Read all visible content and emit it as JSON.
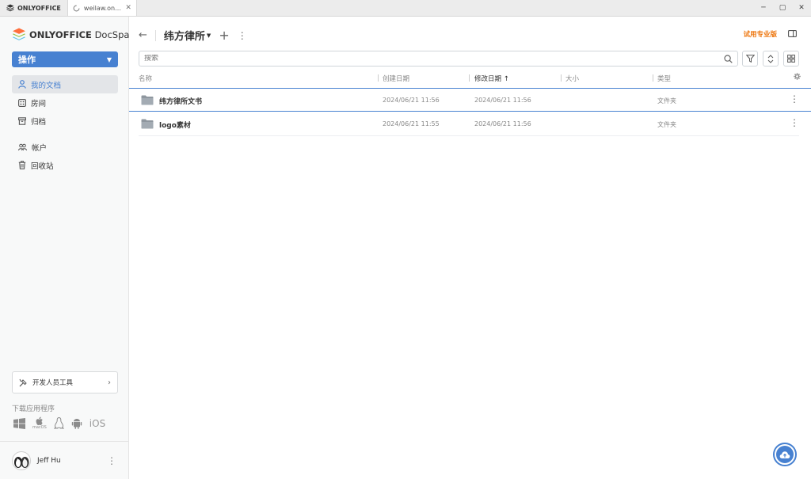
{
  "window": {
    "app_tab_label": "ONLYOFFICE",
    "doc_tab_label": "weilaw.onlyo...",
    "doc_tab_close": "✕"
  },
  "sidebar": {
    "logo_brand": "ONLYOFFICE",
    "logo_product": " DocSpace",
    "action_button": "操作",
    "nav": [
      {
        "label": "我的文档",
        "icon": "person-icon",
        "active": true
      },
      {
        "label": "房间",
        "icon": "rooms-icon",
        "active": false
      },
      {
        "label": "归档",
        "icon": "archive-icon",
        "active": false
      },
      {
        "label": "帐户",
        "icon": "accounts-icon",
        "active": false
      },
      {
        "label": "回收站",
        "icon": "trash-icon",
        "active": false
      }
    ],
    "dev_tools_label": "开发人员工具",
    "download_apps_label": "下载应用程序",
    "os_icons": [
      "windows-icon",
      "macos-icon",
      "linux-icon",
      "android-icon",
      "ios-icon"
    ],
    "macos_caption": "macOS",
    "ios_label": "iOS",
    "user_name": "Jeff Hu"
  },
  "header": {
    "folder_title": "纬方律所",
    "trial_link": "试用专业版"
  },
  "search": {
    "placeholder": "搜索"
  },
  "table": {
    "columns": [
      "名称",
      "创建日期",
      "修改日期",
      "大小",
      "类型"
    ],
    "sort_indicator": "↑",
    "rows": [
      {
        "name": "纬方律所文书",
        "created": "2024/06/21 11:56",
        "modified": "2024/06/21 11:56",
        "size": "",
        "type": "文件夹"
      },
      {
        "name": "logo素材",
        "created": "2024/06/21 11:55",
        "modified": "2024/06/21 11:56",
        "size": "",
        "type": "文件夹"
      }
    ]
  },
  "colors": {
    "accent": "#4781d1",
    "trial": "#ed7309",
    "sidebar_bg": "#f8f9f9"
  }
}
